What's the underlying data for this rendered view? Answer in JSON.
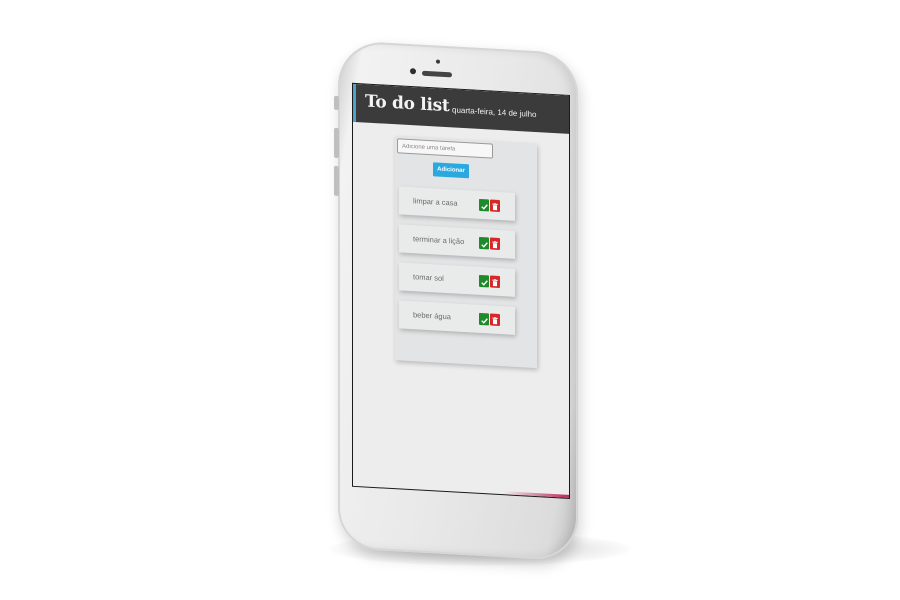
{
  "app": {
    "title": "To do list",
    "date": "quarta-feira, 14 de julho"
  },
  "form": {
    "placeholder": "Adicione uma tarefa",
    "value": "",
    "add_label": "Adicionar"
  },
  "tasks": [
    {
      "label": "limpar a casa",
      "done_icon": "check-icon",
      "delete_icon": "trash-icon"
    },
    {
      "label": "terminar a lição",
      "done_icon": "check-icon",
      "delete_icon": "trash-icon"
    },
    {
      "label": "tomar sol",
      "done_icon": "check-icon",
      "delete_icon": "trash-icon"
    },
    {
      "label": "beber água",
      "done_icon": "check-icon",
      "delete_icon": "trash-icon"
    }
  ],
  "colors": {
    "header_bg": "#3b3b3b",
    "add_button": "#2aa9e0",
    "done_button": "#1f8a2b",
    "delete_button": "#d92629"
  }
}
